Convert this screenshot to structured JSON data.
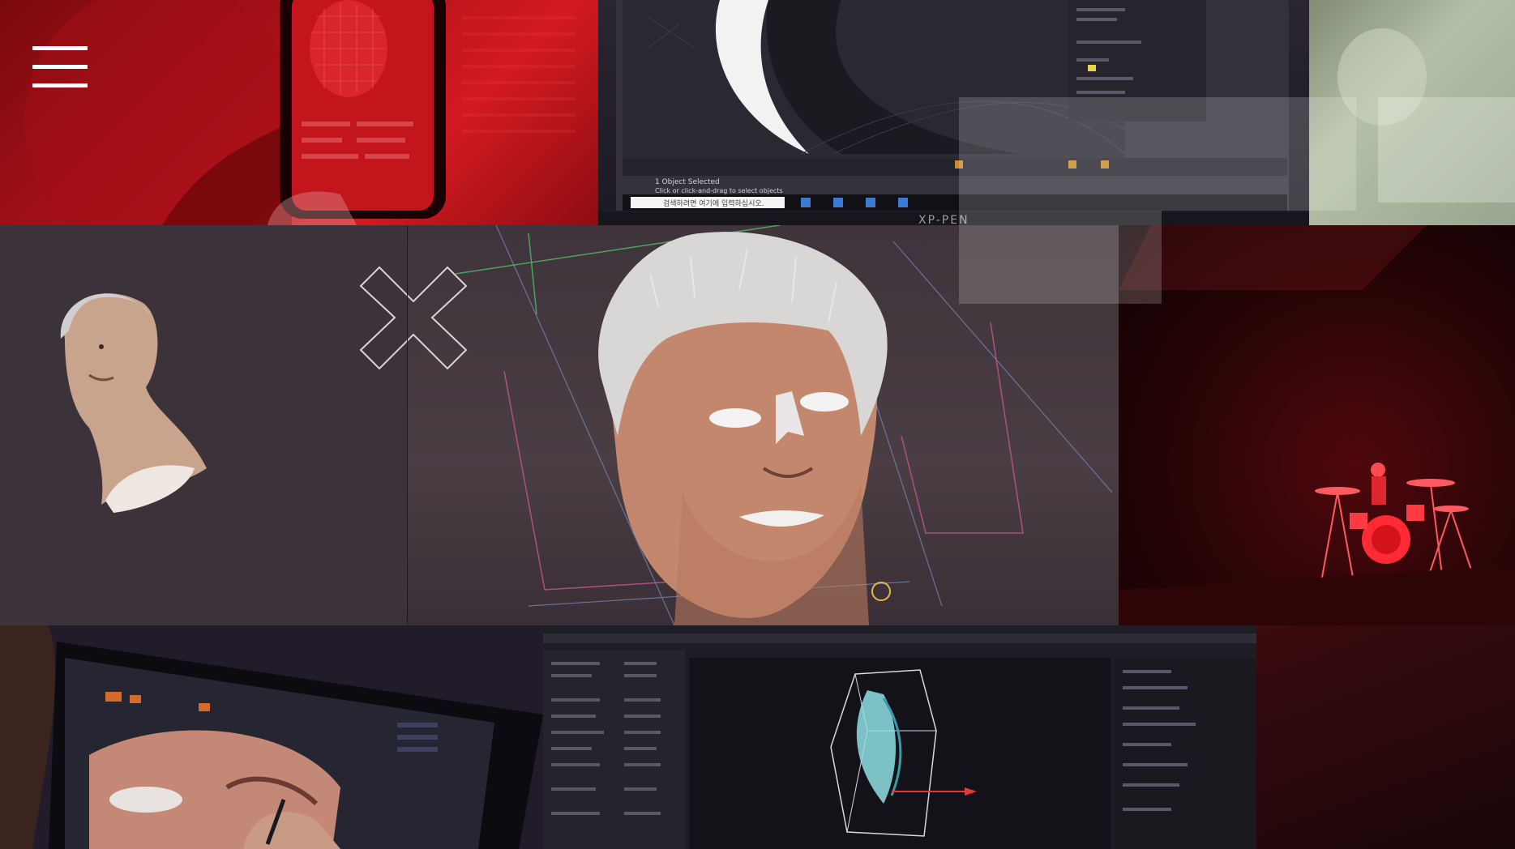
{
  "menu": {
    "icon": "hamburger-menu-icon"
  },
  "monitor": {
    "brand": "XP-PEN",
    "taskbar_search": "검색하려면 여기에 입력하십시오.",
    "status_line1": "1 Object Selected",
    "status_line2": "Click or click-and-drag to select objects"
  },
  "decor": {
    "cross_icon": "x-mark-icon"
  },
  "colors": {
    "accent_red": "#d31a20",
    "dark_bg": "#1a1518",
    "white": "#ffffff"
  }
}
